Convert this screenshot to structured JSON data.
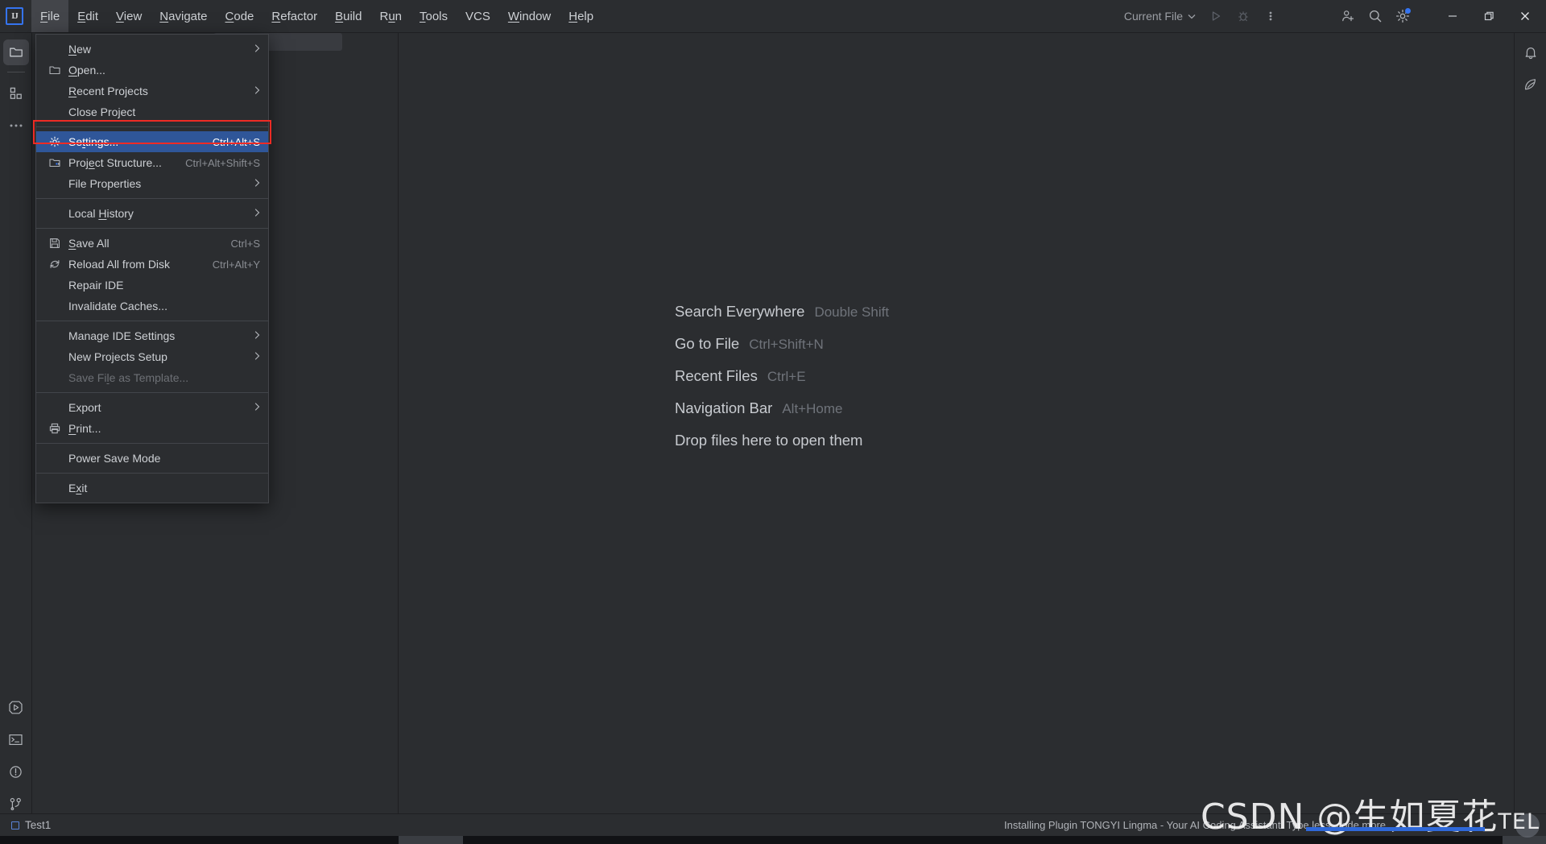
{
  "window": {
    "logo_text": "IJ",
    "run_config": "Current File"
  },
  "menubar": {
    "items": [
      {
        "label": "File",
        "mnemonic": "F",
        "active": true
      },
      {
        "label": "Edit",
        "mnemonic": "E",
        "active": false
      },
      {
        "label": "View",
        "mnemonic": "V",
        "active": false
      },
      {
        "label": "Navigate",
        "mnemonic": "N",
        "active": false
      },
      {
        "label": "Code",
        "mnemonic": "C",
        "active": false
      },
      {
        "label": "Refactor",
        "mnemonic": "R",
        "active": false
      },
      {
        "label": "Build",
        "mnemonic": "B",
        "active": false
      },
      {
        "label": "Run",
        "mnemonic": "u",
        "active": false
      },
      {
        "label": "Tools",
        "mnemonic": "T",
        "active": false
      },
      {
        "label": "VCS",
        "mnemonic": "",
        "active": false
      },
      {
        "label": "Window",
        "mnemonic": "W",
        "active": false
      },
      {
        "label": "Help",
        "mnemonic": "H",
        "active": false
      }
    ]
  },
  "file_menu": {
    "items": [
      {
        "label": "New",
        "mnemonic": "N",
        "shortcut": "",
        "submenu": true,
        "icon": "",
        "selected": false,
        "disabled": false
      },
      {
        "label": "Open...",
        "mnemonic": "O",
        "shortcut": "",
        "submenu": false,
        "icon": "folder-icon",
        "selected": false,
        "disabled": false
      },
      {
        "label": "Recent Projects",
        "mnemonic": "R",
        "shortcut": "",
        "submenu": true,
        "icon": "",
        "selected": false,
        "disabled": false
      },
      {
        "label": "Close Project",
        "mnemonic": "",
        "shortcut": "",
        "submenu": false,
        "icon": "",
        "selected": false,
        "disabled": false
      },
      {
        "separator": true
      },
      {
        "label": "Settings...",
        "mnemonic": "t",
        "shortcut": "Ctrl+Alt+S",
        "submenu": false,
        "icon": "gear-icon",
        "selected": true,
        "disabled": false
      },
      {
        "label": "Project Structure...",
        "mnemonic": "e",
        "shortcut": "Ctrl+Alt+Shift+S",
        "submenu": false,
        "icon": "project-structure-icon",
        "selected": false,
        "disabled": false
      },
      {
        "label": "File Properties",
        "mnemonic": "",
        "shortcut": "",
        "submenu": true,
        "icon": "",
        "selected": false,
        "disabled": false
      },
      {
        "separator": true
      },
      {
        "label": "Local History",
        "mnemonic": "H",
        "shortcut": "",
        "submenu": true,
        "icon": "",
        "selected": false,
        "disabled": false
      },
      {
        "separator": true
      },
      {
        "label": "Save All",
        "mnemonic": "S",
        "shortcut": "Ctrl+S",
        "submenu": false,
        "icon": "save-icon",
        "selected": false,
        "disabled": false
      },
      {
        "label": "Reload All from Disk",
        "mnemonic": "",
        "shortcut": "Ctrl+Alt+Y",
        "submenu": false,
        "icon": "reload-icon",
        "selected": false,
        "disabled": false
      },
      {
        "label": "Repair IDE",
        "mnemonic": "",
        "shortcut": "",
        "submenu": false,
        "icon": "",
        "selected": false,
        "disabled": false
      },
      {
        "label": "Invalidate Caches...",
        "mnemonic": "",
        "shortcut": "",
        "submenu": false,
        "icon": "",
        "selected": false,
        "disabled": false
      },
      {
        "separator": true
      },
      {
        "label": "Manage IDE Settings",
        "mnemonic": "",
        "shortcut": "",
        "submenu": true,
        "icon": "",
        "selected": false,
        "disabled": false
      },
      {
        "label": "New Projects Setup",
        "mnemonic": "",
        "shortcut": "",
        "submenu": true,
        "icon": "",
        "selected": false,
        "disabled": false
      },
      {
        "label": "Save File as Template...",
        "mnemonic": "l",
        "shortcut": "",
        "submenu": false,
        "icon": "",
        "selected": false,
        "disabled": true
      },
      {
        "separator": true
      },
      {
        "label": "Export",
        "mnemonic": "",
        "shortcut": "",
        "submenu": true,
        "icon": "",
        "selected": false,
        "disabled": false
      },
      {
        "label": "Print...",
        "mnemonic": "P",
        "shortcut": "",
        "submenu": false,
        "icon": "print-icon",
        "selected": false,
        "disabled": false
      },
      {
        "separator": true
      },
      {
        "label": "Power Save Mode",
        "mnemonic": "",
        "shortcut": "",
        "submenu": false,
        "icon": "",
        "selected": false,
        "disabled": false
      },
      {
        "separator": true
      },
      {
        "label": "Exit",
        "mnemonic": "x",
        "shortcut": "",
        "submenu": false,
        "icon": "",
        "selected": false,
        "disabled": false
      }
    ]
  },
  "editor_welcome": {
    "rows": [
      {
        "label": "Search Everywhere",
        "key": "Double Shift"
      },
      {
        "label": "Go to File",
        "key": "Ctrl+Shift+N"
      },
      {
        "label": "Recent Files",
        "key": "Ctrl+E"
      },
      {
        "label": "Navigation Bar",
        "key": "Alt+Home"
      },
      {
        "label": "Drop files here to open them",
        "key": ""
      }
    ]
  },
  "left_rail": {
    "top_items": [
      {
        "name": "project-icon",
        "selected": true
      },
      {
        "name": "structure-icon",
        "selected": false
      },
      {
        "name": "more-tool-windows-icon",
        "selected": false
      }
    ],
    "bottom_items": [
      {
        "name": "run-icon",
        "selected": false
      },
      {
        "name": "terminal-icon",
        "selected": false
      },
      {
        "name": "problems-icon",
        "selected": false
      },
      {
        "name": "version-control-icon",
        "selected": false
      }
    ]
  },
  "right_rail": {
    "items": [
      {
        "name": "notifications-bell-icon"
      },
      {
        "name": "ai-assistant-icon"
      }
    ]
  },
  "statusbar": {
    "project_name": "Test1",
    "progress_text": "Installing Plugin TONGYI Lingma - Your AI Coding Assistant. Type less, code more."
  },
  "watermark": {
    "prefix": "CSDN @生如夏花",
    "suffix": "TEL"
  },
  "colors": {
    "accent": "#3574f0",
    "selection": "#2f5699",
    "highlight_box": "#ef2b24",
    "background": "#2b2d30",
    "popup_border": "#43454a"
  }
}
